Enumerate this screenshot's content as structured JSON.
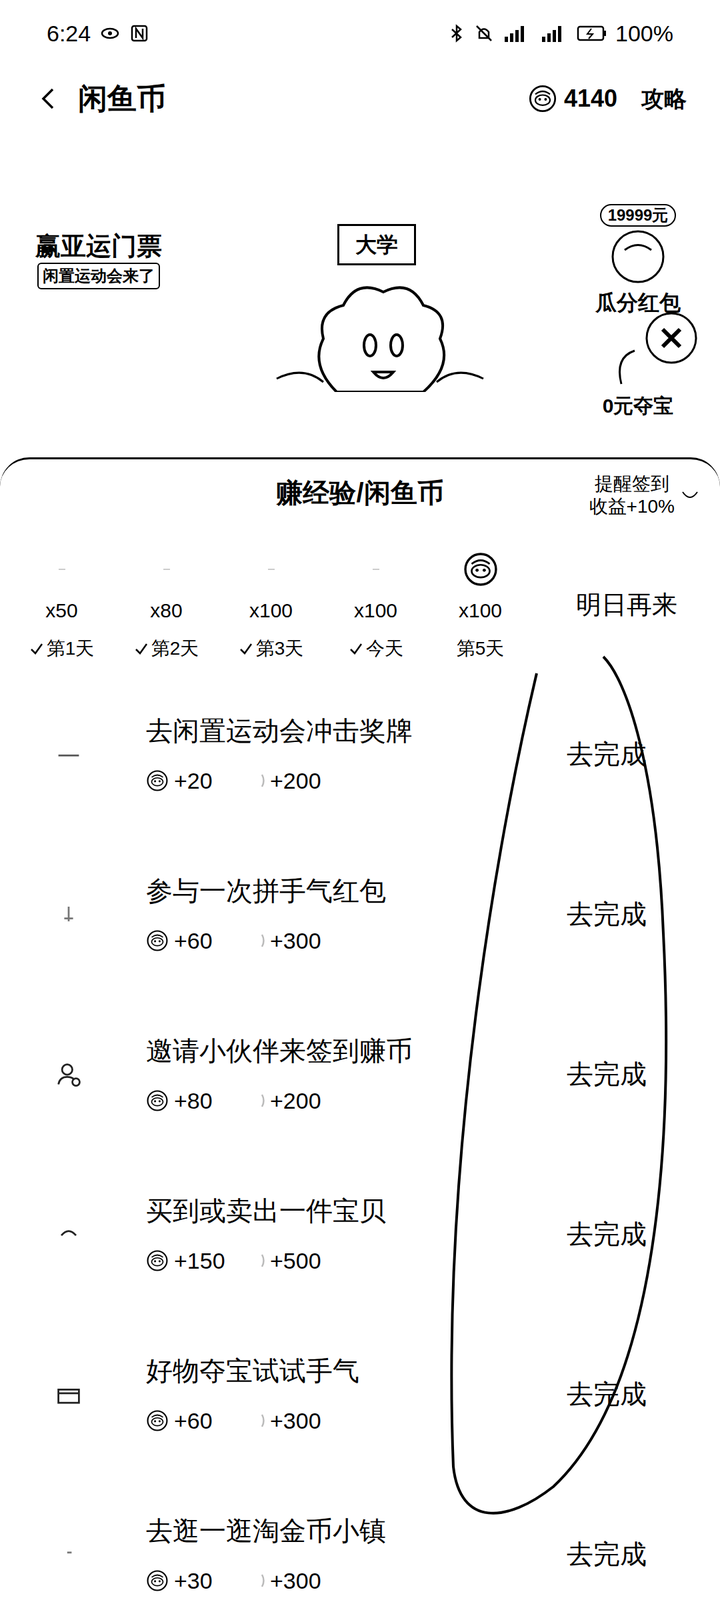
{
  "status_bar": {
    "time": "6:24",
    "battery": "100%"
  },
  "header": {
    "title": "闲鱼币",
    "coins": "4140",
    "guide": "攻略"
  },
  "banner": {
    "promo_title": "赢亚运门票",
    "promo_subtitle": "闲置运动会来了",
    "sign": "大学",
    "red_packet_amount": "19999元",
    "red_packet_label": "瓜分红包",
    "treasure_label": "0元夺宝"
  },
  "panel": {
    "title": "赚经验/闲鱼币",
    "reminder_lines": [
      "提醒签到",
      "收益+10%"
    ]
  },
  "checkin": {
    "days": [
      {
        "reward": "x50",
        "label": "第1天",
        "checked": true
      },
      {
        "reward": "x80",
        "label": "第2天",
        "checked": true
      },
      {
        "reward": "x100",
        "label": "第3天",
        "checked": true
      },
      {
        "reward": "x100",
        "label": "今天",
        "checked": true
      },
      {
        "reward": "x100",
        "label": "第5天",
        "checked": false
      }
    ],
    "button": "明日再来"
  },
  "tasks": [
    {
      "title": "去闲置运动会冲击奖牌",
      "coins": "+20",
      "exp": "+200",
      "button": "去完成"
    },
    {
      "title": "参与一次拼手气红包",
      "coins": "+60",
      "exp": "+300",
      "button": "去完成"
    },
    {
      "title": "邀请小伙伴来签到赚币",
      "coins": "+80",
      "exp": "+200",
      "button": "去完成"
    },
    {
      "title": "买到或卖出一件宝贝",
      "coins": "+150",
      "exp": "+500",
      "button": "去完成"
    },
    {
      "title": "好物夺宝试试手气",
      "coins": "+60",
      "exp": "+300",
      "button": "去完成"
    },
    {
      "title": "去逛一逛淘金币小镇",
      "coins": "+30",
      "exp": "+300",
      "button": "去完成"
    }
  ]
}
